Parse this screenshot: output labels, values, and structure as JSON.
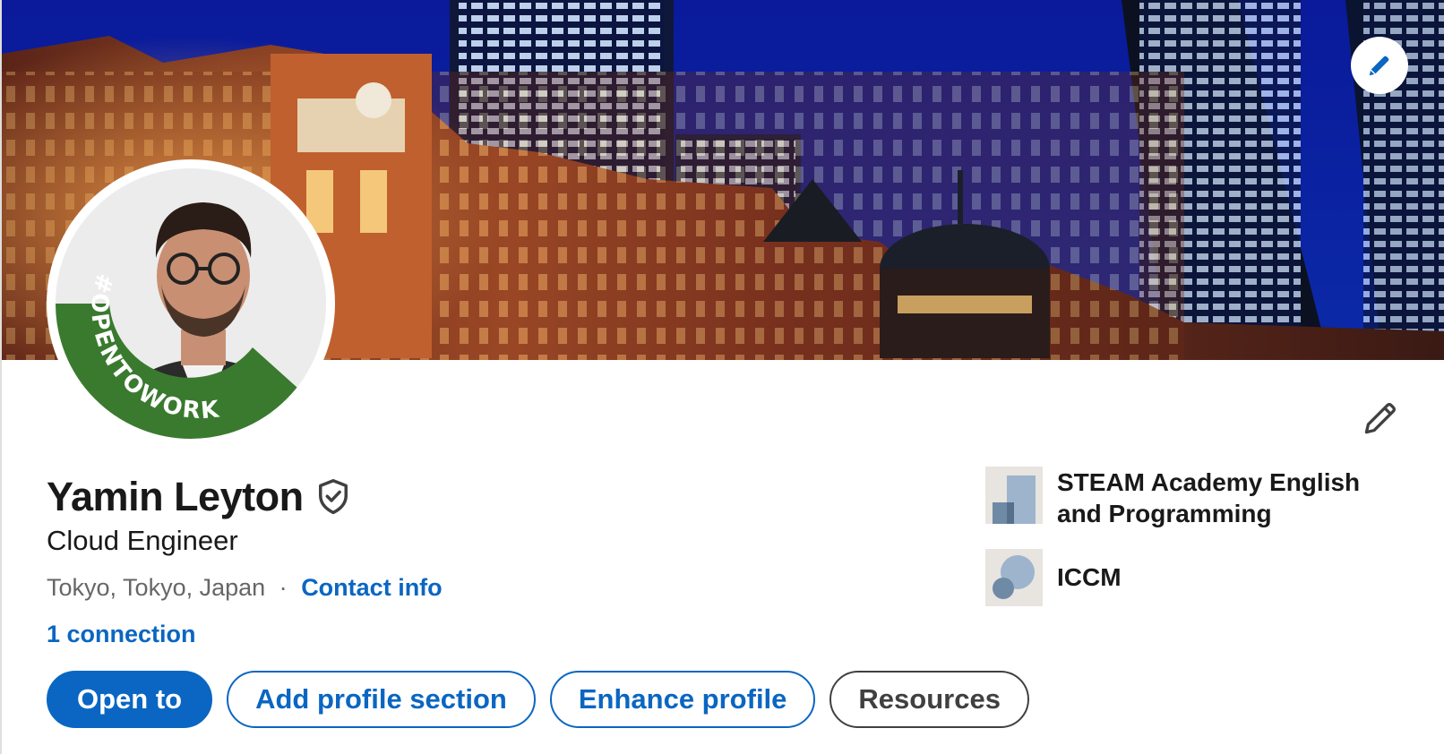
{
  "profile": {
    "name": "Yamin Leyton",
    "headline": "Cloud Engineer",
    "location": "Tokyo, Tokyo, Japan",
    "separator": "·",
    "contact_info_label": "Contact info",
    "connections_label": "1 connection",
    "avatar_badge_text": "#OPENTOWORK"
  },
  "actions": {
    "open_to": "Open to",
    "add_profile_section": "Add profile section",
    "enhance_profile": "Enhance profile",
    "resources": "Resources"
  },
  "organizations": [
    {
      "name": "STEAM Academy English and Programming"
    },
    {
      "name": "ICCM"
    }
  ],
  "icons": {
    "cover_edit": "pencil-icon",
    "intro_edit": "pencil-outline-icon",
    "verified": "verified-shield-icon"
  },
  "colors": {
    "brand_blue": "#0a66c2",
    "open_to_work_green": "#3a7a2f",
    "text_primary": "#191919",
    "text_secondary": "#666666"
  }
}
